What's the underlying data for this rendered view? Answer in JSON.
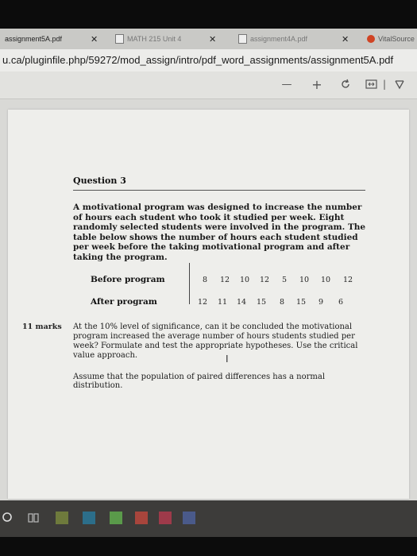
{
  "browser": {
    "tabs": [
      {
        "label": "assignment5A.pdf",
        "active": true
      },
      {
        "label": "MATH 215 Unit 4",
        "active": false
      },
      {
        "label": "assignment4A.pdf",
        "active": false
      },
      {
        "label": "VitalSource",
        "active": false
      }
    ],
    "address": "u.ca/pluginfile.php/59272/mod_assign/intro/pdf_word_assignments/assignment5A.pdf",
    "toolbar": {
      "zoom_out": "—",
      "zoom_in": "+"
    }
  },
  "document": {
    "question_title": "Question 3",
    "intro": "A motivational program was designed to increase the number of hours each student who took it studied per week. Eight randomly selected students were involved in the program. The table below shows the number of hours each student studied per week before the taking motivational program and after taking the program.",
    "table": {
      "before_label": "Before program",
      "after_label": "After program",
      "before": [
        "8",
        "12",
        "10",
        "12",
        "5",
        "10",
        "10",
        "12"
      ],
      "after": [
        "12",
        "11",
        "14",
        "15",
        "8",
        "15",
        "9",
        "6"
      ]
    },
    "marks": "11 marks",
    "task": "At the 10% level of significance, can it be concluded the motivational program increased the average number of hours students studied per week? Formulate and test the appropriate hypotheses. Use the critical value approach.",
    "assumption": "Assume that the population of paired differences has a normal distribution."
  },
  "colors": {
    "background": "#0c0c0c",
    "page": "#eeeeeb",
    "taskbar": "#3d3c3a"
  }
}
